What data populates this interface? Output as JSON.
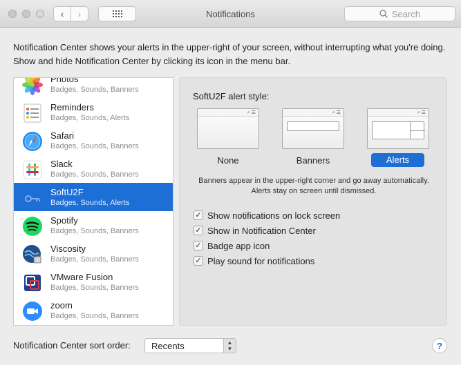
{
  "window": {
    "title": "Notifications",
    "search_placeholder": "Search"
  },
  "description": "Notification Center shows your alerts in the upper-right of your screen, without interrupting what you're doing. Show and hide Notification Center by clicking its icon in the menu bar.",
  "apps": [
    {
      "name": "Photos",
      "sub": "Badges, Sounds, Banners",
      "icon": "photos-icon"
    },
    {
      "name": "Reminders",
      "sub": "Badges, Sounds, Alerts",
      "icon": "reminders-icon"
    },
    {
      "name": "Safari",
      "sub": "Badges, Sounds, Banners",
      "icon": "safari-icon"
    },
    {
      "name": "Slack",
      "sub": "Badges, Sounds, Banners",
      "icon": "slack-icon"
    },
    {
      "name": "SoftU2F",
      "sub": "Badges, Sounds, Alerts",
      "icon": "key-icon",
      "selected": true
    },
    {
      "name": "Spotify",
      "sub": "Badges, Sounds, Banners",
      "icon": "spotify-icon"
    },
    {
      "name": "Viscosity",
      "sub": "Badges, Sounds, Banners",
      "icon": "viscosity-icon"
    },
    {
      "name": "VMware Fusion",
      "sub": "Badges, Sounds, Banners",
      "icon": "vmware-icon"
    },
    {
      "name": "zoom",
      "sub": "Badges, Sounds, Banners",
      "icon": "zoom-icon"
    }
  ],
  "pane": {
    "alert_style_label": "SoftU2F alert style:",
    "styles": [
      {
        "label": "None",
        "selected": false
      },
      {
        "label": "Banners",
        "selected": false
      },
      {
        "label": "Alerts",
        "selected": true
      }
    ],
    "note": "Banners appear in the upper-right corner and go away automatically. Alerts stay on screen until dismissed.",
    "checkboxes": [
      {
        "label": "Show notifications on lock screen",
        "checked": true
      },
      {
        "label": "Show in Notification Center",
        "checked": true
      },
      {
        "label": "Badge app icon",
        "checked": true
      },
      {
        "label": "Play sound for notifications",
        "checked": true
      }
    ]
  },
  "sort": {
    "label": "Notification Center sort order:",
    "value": "Recents"
  },
  "help_label": "?",
  "colors": {
    "accent": "#1d6fd6",
    "pane_bg": "#e3e3e3",
    "window_bg": "#ececec"
  }
}
